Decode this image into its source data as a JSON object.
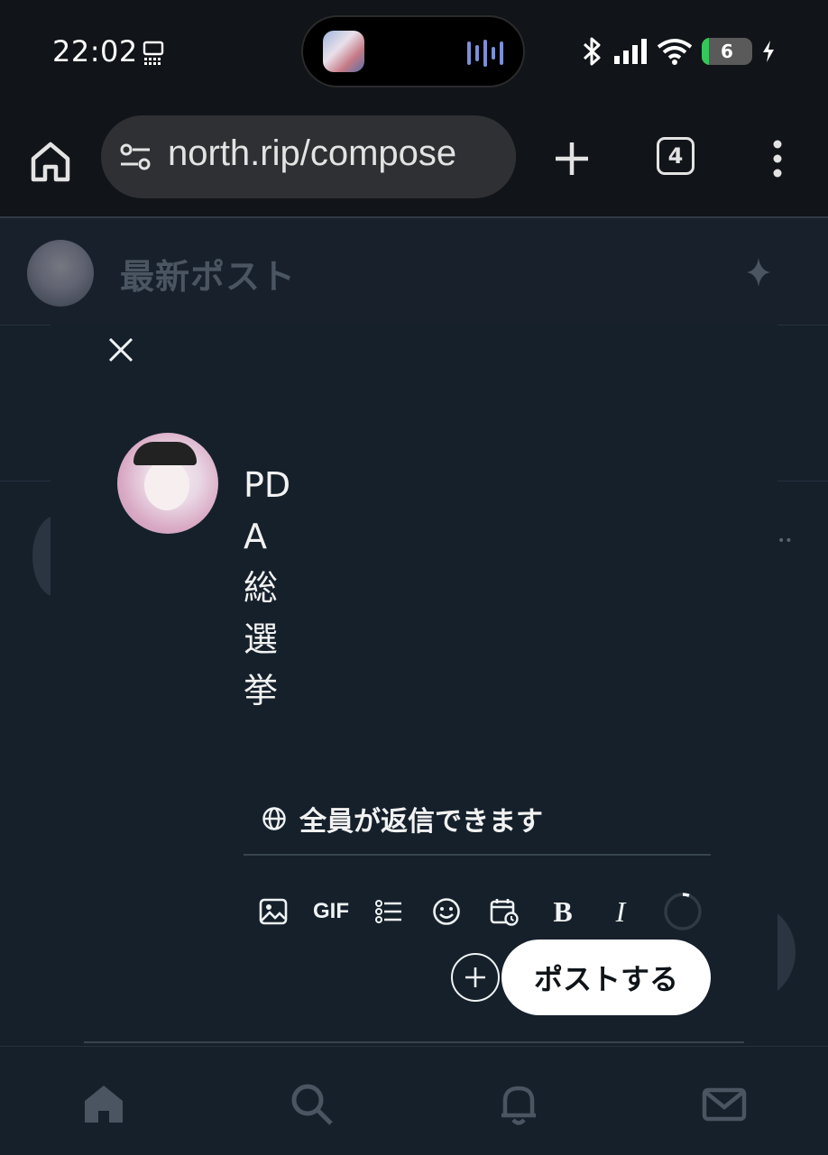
{
  "status_bar": {
    "time": "22:02",
    "battery_level": "6",
    "icons": [
      "cast-icon",
      "bluetooth-icon",
      "signal-icon",
      "wifi-icon",
      "battery-icon",
      "charging-icon"
    ]
  },
  "browser": {
    "url": "north.rip/compose",
    "tab_count": "4",
    "icons": [
      "home-icon",
      "tune-icon",
      "plus-icon",
      "more-vert-icon"
    ]
  },
  "feed": {
    "header_title": "最新ポスト",
    "header_icon": "sparkle-icon"
  },
  "compose": {
    "post_text": "PDA総選挙",
    "reply_setting": "全員が返信できます",
    "toolbar": {
      "image_icon": "image-icon",
      "gif_label": "GIF",
      "poll_icon": "list-icon",
      "emoji_icon": "emoji-icon",
      "schedule_icon": "calendar-icon",
      "bold_label": "B",
      "italic_label": "I",
      "counter_icon": "progress-ring-icon"
    },
    "post_button": "ポストする"
  },
  "bottom_nav": {
    "items": [
      "home-icon",
      "search-icon",
      "bell-icon",
      "mail-icon"
    ]
  },
  "colors": {
    "background": "#15202b",
    "chrome": "#111418",
    "url_pill": "#2e3033",
    "post_button_bg": "#ffffff",
    "text": "#e7e9ea",
    "separator": "#38444d"
  }
}
